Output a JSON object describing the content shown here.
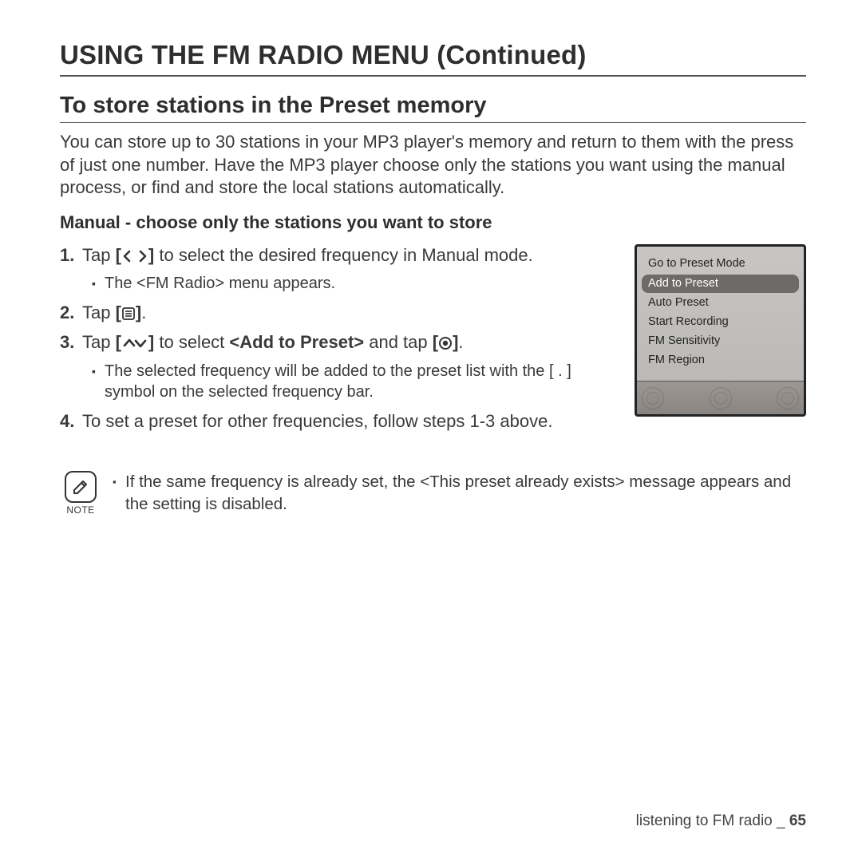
{
  "page_title": "USING THE FM RADIO MENU (Continued)",
  "section_title": "To store stations in the Preset memory",
  "intro": "You can store up to 30 stations in your MP3 player's memory and return to them with the press of just one number. Have the MP3 player choose only the stations you want using the manual process, or find and store the local stations automatically.",
  "subsection": "Manual - choose only the stations you want to store",
  "steps": {
    "s1_num": "1.",
    "s1_a": "Tap ",
    "s1_b": " to select the desired frequency in Manual mode.",
    "s1_bullet": "The <FM Radio> menu appears.",
    "s2_num": "2.",
    "s2_a": "Tap ",
    "s2_b": ".",
    "s3_num": "3.",
    "s3_a": "Tap ",
    "s3_b": " to select ",
    "s3_bold": "<Add to Preset>",
    "s3_c": " and tap ",
    "s3_d": ".",
    "s3_bullet": "The selected frequency will be added to the preset list with the [ . ] symbol on the selected frequency bar.",
    "s4_num": "4.",
    "s4_a": "To set a preset for other frequencies, follow steps 1-3 above."
  },
  "device_menu": {
    "items": [
      "Go to Preset Mode",
      "Add to Preset",
      "Auto Preset",
      "Start Recording",
      "FM Sensitivity",
      "FM Region"
    ],
    "selected_index": 1
  },
  "note_label": "NOTE",
  "note_text": "If the same frequency is already set, the <This preset already exists> message appears and the setting is disabled.",
  "footer_section": "listening to FM radio _ ",
  "footer_page": "65",
  "icons": {
    "left_right": "[ ‹  › ]",
    "menu": "[ ≡ ]",
    "up_down_open": "[ ",
    "up_down_close": " ]",
    "circle_open": "[ ",
    "circle_close": " ]"
  }
}
